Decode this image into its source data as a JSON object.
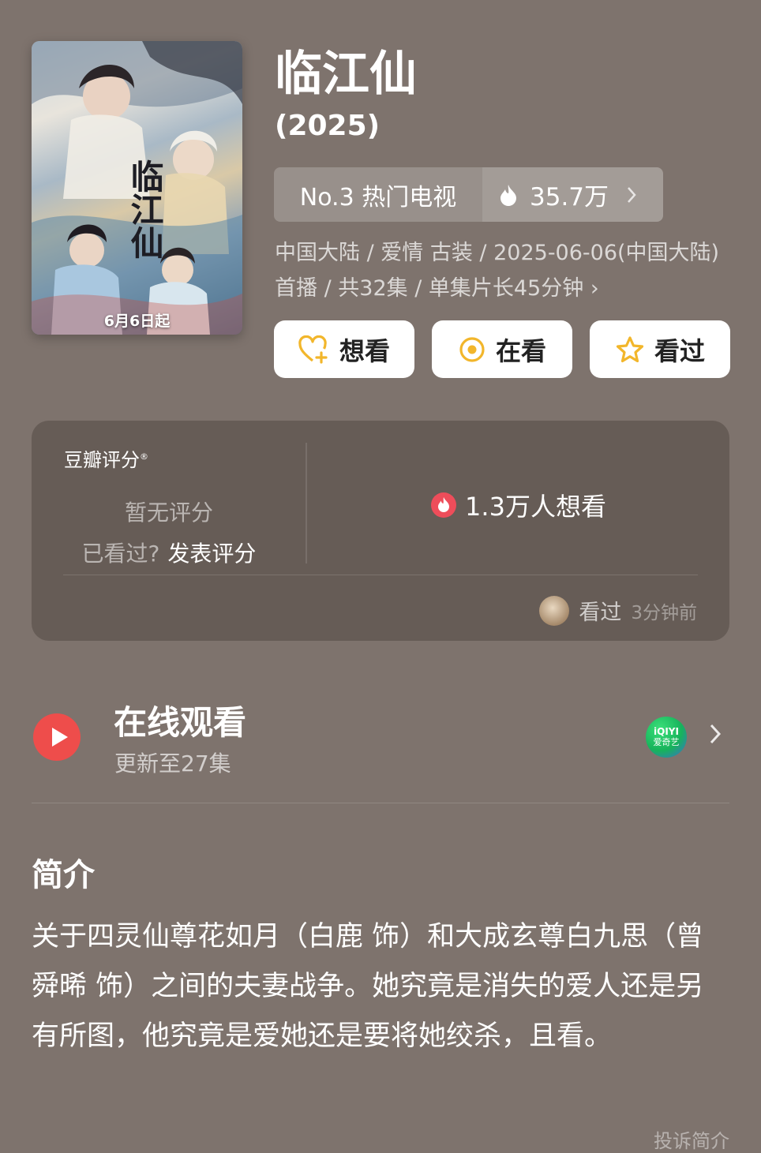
{
  "poster": {
    "title_art": "临江仙",
    "date_badge": "6月6日起"
  },
  "header": {
    "title": "临江仙",
    "year": "(2025)"
  },
  "rank": {
    "label": "No.3 热门电视",
    "heat": "35.7万",
    "icons": [
      "fire-icon",
      "chevron-right-icon"
    ]
  },
  "meta": {
    "info": "中国大陆 / 爱情 古装 / 2025-06-06(中国大陆)首播 / 共32集 / 单集片长45分钟 ›"
  },
  "actions": [
    {
      "label": "想看",
      "icon": "heart-plus-icon"
    },
    {
      "label": "在看",
      "icon": "target-icon"
    },
    {
      "label": "看过",
      "icon": "star-icon"
    }
  ],
  "rating": {
    "label": "豆瓣评分",
    "registered_mark": "®",
    "no_rating": "暂无评分",
    "seen_question": "已看过?",
    "post_rating": "发表评分",
    "want_count": "1.3万人想看",
    "activity_label": "看过",
    "activity_time": "3分钟前"
  },
  "online": {
    "title": "在线观看",
    "update": "更新至27集",
    "provider_en": "iQIYI",
    "provider_cn": "爱奇艺"
  },
  "intro": {
    "heading": "简介",
    "text": "关于四灵仙尊花如月（白鹿 饰）和大成玄尊白九思（曾舜晞 饰）之间的夫妻战争。她究竟是消失的爱人还是另有所图，他究竟是爱她还是要将她绞杀，且看。"
  },
  "footer": {
    "report": "投诉简介"
  },
  "colors": {
    "background": "#7e736d",
    "card": "#665c56",
    "accent_yellow": "#f2b62b",
    "play_red": "#ee4d4b",
    "iqiyi_green": "#17b35b"
  }
}
